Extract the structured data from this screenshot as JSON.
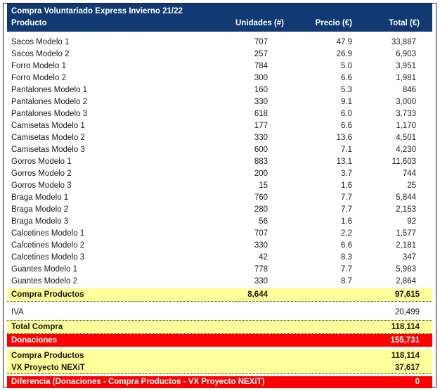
{
  "header": {
    "title": "Compra Voluntariado Express Invierno 21/22",
    "col_product": "Producto",
    "col_units": "Unidades (#)",
    "col_price": "Precio (€)",
    "col_total": "Total (€)"
  },
  "rows": [
    {
      "name": "Sacos Modelo 1",
      "units": "707",
      "price": "47.9",
      "total": "33,887"
    },
    {
      "name": "Sacos Modelo 2",
      "units": "257",
      "price": "26.9",
      "total": "6,903"
    },
    {
      "name": "Forro Modelo 1",
      "units": "784",
      "price": "5.0",
      "total": "3,951"
    },
    {
      "name": "Forro Modelo 2",
      "units": "300",
      "price": "6.6",
      "total": "1,981"
    },
    {
      "name": "Pantalones Modelo 1",
      "units": "160",
      "price": "5.3",
      "total": "846"
    },
    {
      "name": "Pantalones Modelo 2",
      "units": "330",
      "price": "9.1",
      "total": "3,000"
    },
    {
      "name": "Pantalones Modelo 3",
      "units": "618",
      "price": "6.0",
      "total": "3,733"
    },
    {
      "name": "Camisetas Modelo 1",
      "units": "177",
      "price": "6.6",
      "total": "1,170"
    },
    {
      "name": "Camisetas Modelo 2",
      "units": "330",
      "price": "13.6",
      "total": "4,501"
    },
    {
      "name": "Camisetas Modelo 3",
      "units": "600",
      "price": "7.1",
      "total": "4,230"
    },
    {
      "name": "Gorros Modelo 1",
      "units": "883",
      "price": "13.1",
      "total": "11,603"
    },
    {
      "name": "Gorros Modelo 2",
      "units": "200",
      "price": "3.7",
      "total": "744"
    },
    {
      "name": "Gorros Modelo 3",
      "units": "15",
      "price": "1.6",
      "total": "25"
    },
    {
      "name": "Braga Modelo 1",
      "units": "760",
      "price": "7.7",
      "total": "5,844"
    },
    {
      "name": "Braga Modelo 2",
      "units": "280",
      "price": "7.7",
      "total": "2,153"
    },
    {
      "name": "Braga Modelo 3",
      "units": "56",
      "price": "1.6",
      "total": "92"
    },
    {
      "name": "Calcetines Modelo 1",
      "units": "707",
      "price": "2.2",
      "total": "1,577"
    },
    {
      "name": "Calcetines Modelo 2",
      "units": "330",
      "price": "6.6",
      "total": "2,181"
    },
    {
      "name": "Calcetines Modelo 3",
      "units": "42",
      "price": "8.3",
      "total": "347"
    },
    {
      "name": "Guantes Modelo 1",
      "units": "778",
      "price": "7.7",
      "total": "5,983"
    },
    {
      "name": "Guantes Modelo 2",
      "units": "330",
      "price": "8.7",
      "total": "2,864"
    }
  ],
  "subtotal": {
    "name": "Compra Productos",
    "units": "8,644",
    "total": "97,615"
  },
  "iva": {
    "name": "IVA",
    "total": "20,499"
  },
  "total_compra": {
    "name": "Total Compra",
    "total": "118,114"
  },
  "donaciones": {
    "name": "Donaciones",
    "total": "155,731"
  },
  "compra_productos": {
    "name": "Compra Productos",
    "total": "118,114"
  },
  "vx_proyecto": {
    "name": "VX Proyecto NEXiT",
    "total": "37,617"
  },
  "diferencia": {
    "name": "Diferencia (Donaciones - Compra Productos - VX Proyecto NEXiT)",
    "total": "0"
  },
  "colors": {
    "header": "#123a72",
    "highlight": "#ffff99",
    "alert": "#ff0000"
  }
}
